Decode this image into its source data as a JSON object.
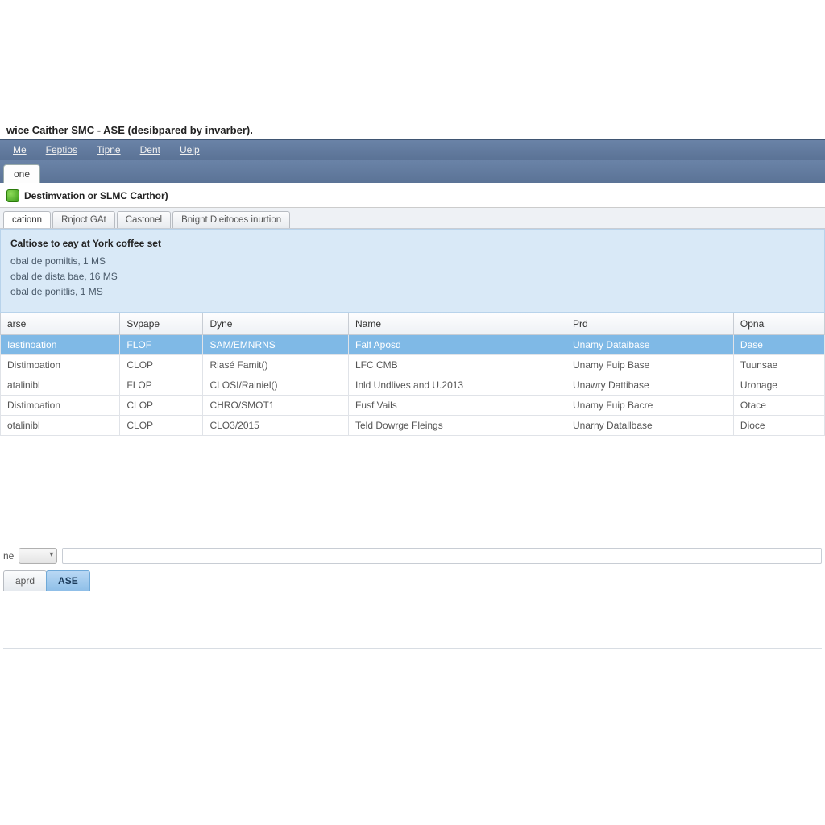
{
  "window": {
    "title": "wice Caither SMC - ASE  (desibpared by invarber)."
  },
  "menubar": {
    "items": [
      "Me",
      "Feptios",
      "Tipne",
      "Dent",
      "Uelp"
    ]
  },
  "outer_tabs": {
    "items": [
      "one"
    ]
  },
  "section": {
    "title": "Destimvation or SLMC Carthor)"
  },
  "inner_tabs": {
    "items": [
      "cationn",
      "Rnjoct GAt",
      "Castonel",
      "Bnignt Dieitoces inurtion"
    ],
    "active_index": 0
  },
  "info_panel": {
    "title": "Caltiose to eay at York coffee set",
    "lines": [
      "obal de pomiltis, 1 MS",
      "obal de dista bae, 16 MS",
      "obal de ponitlis, 1 MS"
    ]
  },
  "grid": {
    "columns": [
      "arse",
      "Svpape",
      "Dyne",
      "Name",
      "Prd",
      "Opna"
    ],
    "rows": [
      {
        "cells": [
          "Iastinoation",
          "FLOF",
          "SAM/EMNRNS",
          "Falf Aposd",
          "Unamy Dataibase",
          "Dase"
        ],
        "selected": true
      },
      {
        "cells": [
          "Distimoation",
          "CLOP",
          "Riasé Famit()",
          "LFC CMB",
          "Unamy Fuip Base",
          "Tuunsae"
        ],
        "selected": false
      },
      {
        "cells": [
          "atalinibl",
          "FLOP",
          "CLOSI/Rainiel()",
          "Inld Undlives and U.2013",
          "Unawry Dattibase",
          "Uronage"
        ],
        "selected": false
      },
      {
        "cells": [
          "Distimoation",
          "CLOP",
          "CHRO/SMOT1",
          "Fusf Vails",
          "Unamy Fuip Bacre",
          "Otace"
        ],
        "selected": false
      },
      {
        "cells": [
          "otalinibl",
          "CLOP",
          "CLO3/2015",
          "Teld Dowrge Fleings",
          "Unarny Datallbase",
          "Dioce"
        ],
        "selected": false
      }
    ]
  },
  "filter": {
    "label": "ne"
  },
  "bottom_tabs": {
    "items": [
      "aprd",
      "ASE"
    ],
    "active_index": 1
  }
}
